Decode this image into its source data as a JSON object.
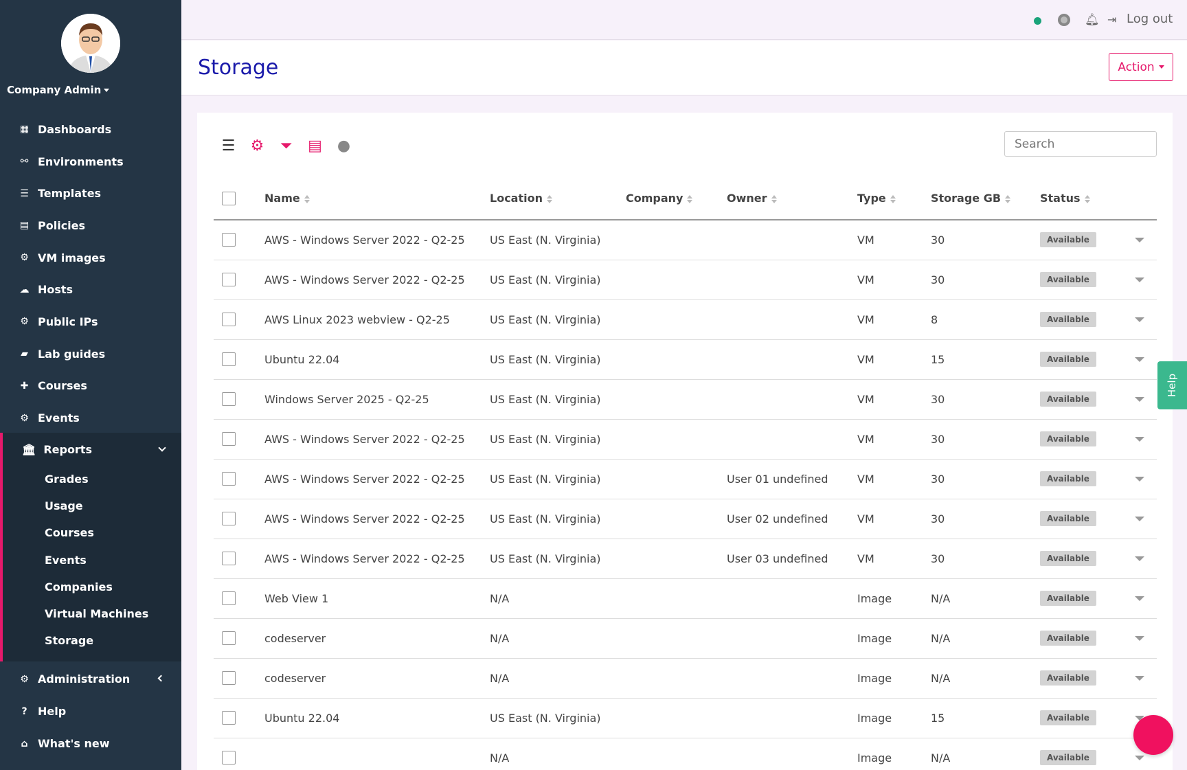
{
  "sidebar": {
    "user": "Company Admin",
    "items": [
      {
        "label": "Dashboards",
        "icon": "dashboard-icon"
      },
      {
        "label": "Environments",
        "icon": "sitemap-icon"
      },
      {
        "label": "Templates",
        "icon": "sliders-icon"
      },
      {
        "label": "Policies",
        "icon": "document-icon"
      },
      {
        "label": "VM images",
        "icon": "cogs-icon"
      },
      {
        "label": "Hosts",
        "icon": "cloud-icon"
      },
      {
        "label": "Public IPs",
        "icon": "cogs-icon"
      },
      {
        "label": "Lab guides",
        "icon": "book-icon"
      },
      {
        "label": "Courses",
        "icon": "puzzle-icon"
      },
      {
        "label": "Events",
        "icon": "cogs-icon"
      }
    ],
    "reports": {
      "label": "Reports",
      "items": [
        "Grades",
        "Usage",
        "Courses",
        "Events",
        "Companies",
        "Virtual Machines",
        "Storage"
      ]
    },
    "bottom": [
      {
        "label": "Administration",
        "icon": "cogs-icon"
      },
      {
        "label": "Help",
        "icon": "question-icon"
      },
      {
        "label": "What's new",
        "icon": "gift-icon"
      }
    ]
  },
  "topbar": {
    "logout": "Log out",
    "status_color": "#1aa37a"
  },
  "header": {
    "title": "Storage",
    "action": "Action"
  },
  "search": {
    "placeholder": "Search"
  },
  "table": {
    "columns": [
      "Name",
      "Location",
      "Company",
      "Owner",
      "Type",
      "Storage GB",
      "Status"
    ],
    "rows": [
      [
        "AWS - Windows Server 2022 - Q2-25",
        "US East (N. Virginia)",
        "",
        "",
        "VM",
        "30",
        "Available"
      ],
      [
        "AWS - Windows Server 2022 - Q2-25",
        "US East (N. Virginia)",
        "",
        "",
        "VM",
        "30",
        "Available"
      ],
      [
        "AWS Linux 2023 webview - Q2-25",
        "US East (N. Virginia)",
        "",
        "",
        "VM",
        "8",
        "Available"
      ],
      [
        "Ubuntu 22.04",
        "US East (N. Virginia)",
        "",
        "",
        "VM",
        "15",
        "Available"
      ],
      [
        "Windows Server 2025 - Q2-25",
        "US East (N. Virginia)",
        "",
        "",
        "VM",
        "30",
        "Available"
      ],
      [
        "AWS - Windows Server 2022 - Q2-25",
        "US East (N. Virginia)",
        "",
        "",
        "VM",
        "30",
        "Available"
      ],
      [
        "AWS - Windows Server 2022 - Q2-25",
        "US East (N. Virginia)",
        "",
        "User 01 undefined",
        "VM",
        "30",
        "Available"
      ],
      [
        "AWS - Windows Server 2022 - Q2-25",
        "US East (N. Virginia)",
        "",
        "User 02 undefined",
        "VM",
        "30",
        "Available"
      ],
      [
        "AWS - Windows Server 2022 - Q2-25",
        "US East (N. Virginia)",
        "",
        "User 03 undefined",
        "VM",
        "30",
        "Available"
      ],
      [
        "Web View 1",
        "N/A",
        "",
        "",
        "Image",
        "N/A",
        "Available"
      ],
      [
        "codeserver",
        "N/A",
        "",
        "",
        "Image",
        "N/A",
        "Available"
      ],
      [
        "codeserver",
        "N/A",
        "",
        "",
        "Image",
        "N/A",
        "Available"
      ],
      [
        "Ubuntu 22.04",
        "US East (N. Virginia)",
        "",
        "",
        "Image",
        "15",
        "Available"
      ],
      [
        "",
        "N/A",
        "",
        "",
        "Image",
        "N/A",
        "Available"
      ]
    ]
  },
  "help_tab": "Help",
  "colors": {
    "accent": "#e6196b",
    "sidebar": "#243545",
    "title": "#1a1aaa",
    "help": "#3bb88e"
  }
}
